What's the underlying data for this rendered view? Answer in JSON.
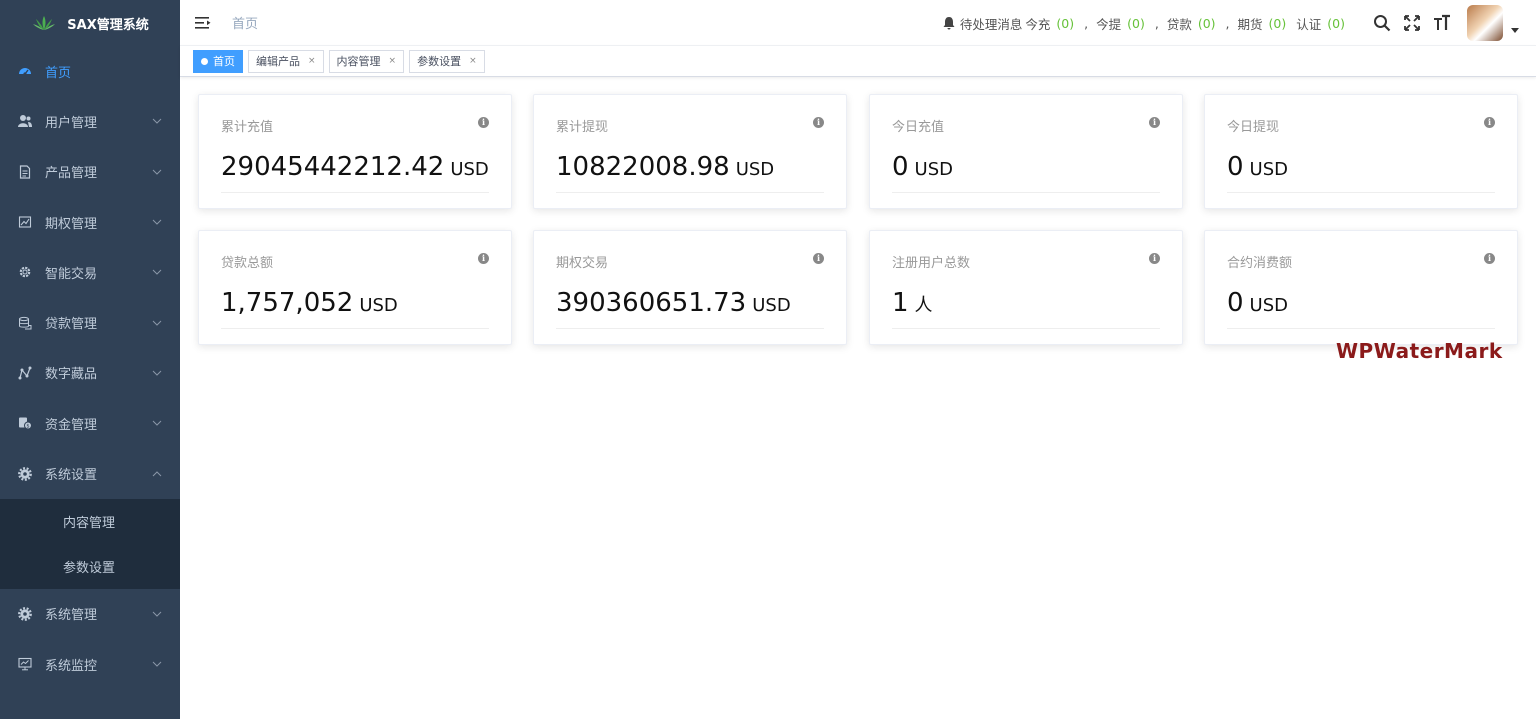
{
  "app": {
    "title": "SAX管理系统"
  },
  "sidebar": {
    "items": [
      {
        "label": "首页",
        "icon": "dashboard-icon",
        "active": true
      },
      {
        "label": "用户管理",
        "icon": "user-icon"
      },
      {
        "label": "产品管理",
        "icon": "document-icon"
      },
      {
        "label": "期权管理",
        "icon": "chart-icon"
      },
      {
        "label": "智能交易",
        "icon": "gear-icon"
      },
      {
        "label": "贷款管理",
        "icon": "coins-icon"
      },
      {
        "label": "数字藏品",
        "icon": "graph-icon"
      },
      {
        "label": "资金管理",
        "icon": "money-icon"
      },
      {
        "label": "系统设置",
        "icon": "settings-icon",
        "expanded": true
      }
    ],
    "submenu": [
      {
        "label": "内容管理"
      },
      {
        "label": "参数设置"
      }
    ],
    "items_after": [
      {
        "label": "系统管理",
        "icon": "settings-icon"
      },
      {
        "label": "系统监控",
        "icon": "monitor-icon"
      }
    ]
  },
  "header": {
    "breadcrumb": "首页",
    "notice": {
      "label": "待处理消息",
      "items": [
        {
          "label": "今充",
          "count": "(0)"
        },
        {
          "label": "今提",
          "count": "(0)"
        },
        {
          "label": "贷款",
          "count": "(0)"
        },
        {
          "label": "期货",
          "count": "(0)"
        },
        {
          "label": "认证",
          "count": "(0)"
        }
      ],
      "separator": ","
    }
  },
  "tags": [
    {
      "label": "首页",
      "active": true
    },
    {
      "label": "编辑产品",
      "close": "×"
    },
    {
      "label": "内容管理",
      "close": "×"
    },
    {
      "label": "参数设置",
      "close": "×"
    }
  ],
  "cards": [
    {
      "label": "累计充值",
      "value": "29045442212.42",
      "unit": "USD"
    },
    {
      "label": "累计提现",
      "value": "10822008.98",
      "unit": "USD"
    },
    {
      "label": "今日充值",
      "value": "0",
      "unit": "USD"
    },
    {
      "label": "今日提现",
      "value": "0",
      "unit": "USD"
    },
    {
      "label": "贷款总额",
      "value": "1,757,052",
      "unit": "USD"
    },
    {
      "label": "期权交易",
      "value": "390360651.73",
      "unit": "USD"
    },
    {
      "label": "注册用户总数",
      "value": "1",
      "unit": "人"
    },
    {
      "label": "合约消费额",
      "value": "0",
      "unit": "USD"
    }
  ],
  "info_glyph": "i",
  "watermark": "WPWaterMark",
  "colors": {
    "sidebar": "#304156",
    "accent": "#409eff",
    "count": "#67c23a"
  }
}
